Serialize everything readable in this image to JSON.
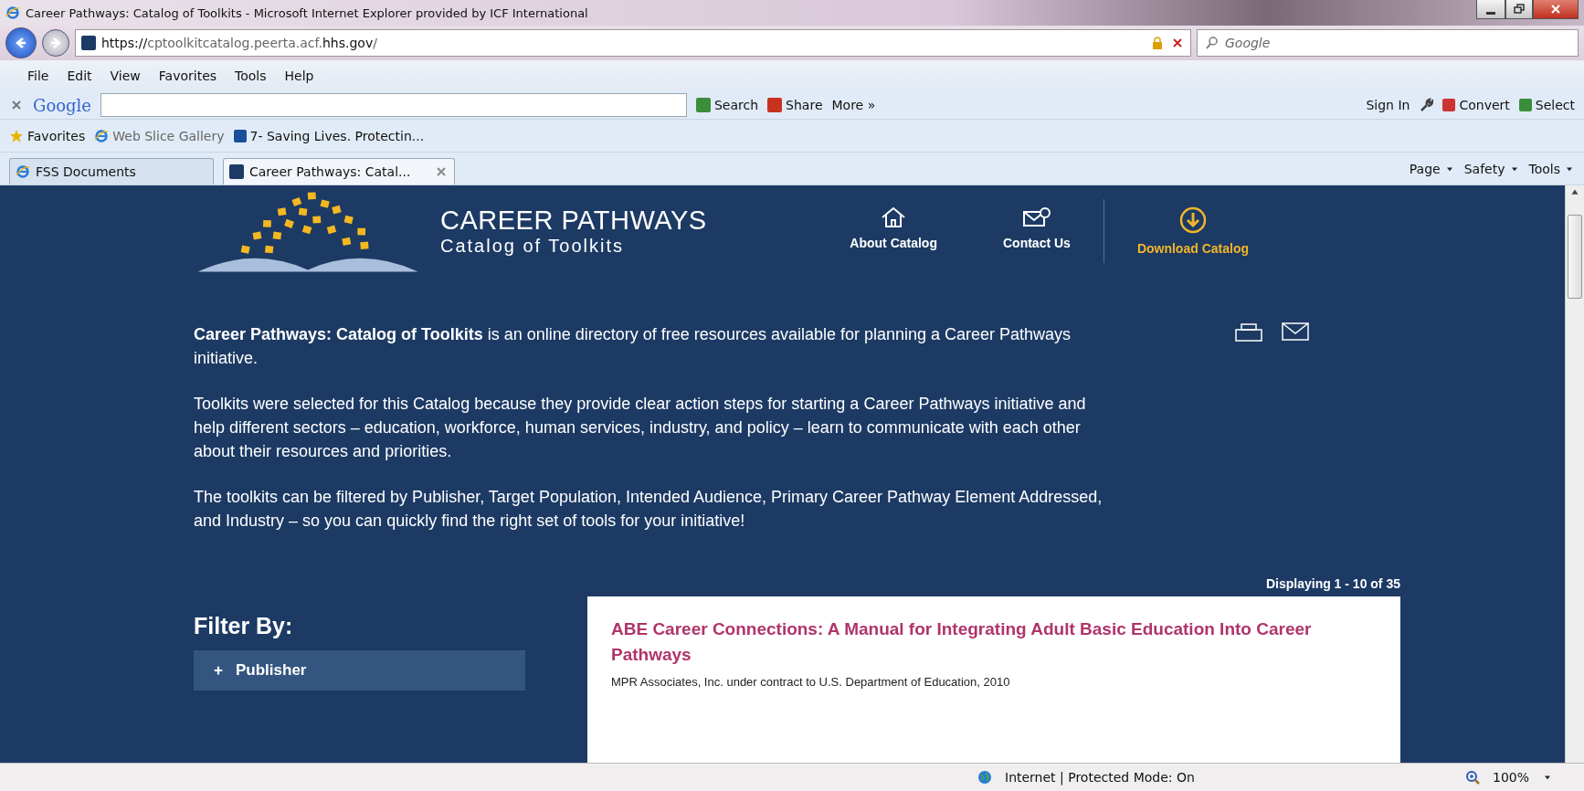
{
  "window": {
    "title": "Career Pathways: Catalog of Toolkits - Microsoft Internet Explorer provided by ICF International"
  },
  "address": {
    "url_prefix": "https://",
    "url_host": "cptoolkitcatalog.peerta.acf.",
    "url_domain": "hhs.gov",
    "url_suffix": "/",
    "search_placeholder": "Google"
  },
  "menu": [
    "File",
    "Edit",
    "View",
    "Favorites",
    "Tools",
    "Help"
  ],
  "google_bar": {
    "logo": "Google",
    "search": "Search",
    "share": "Share",
    "more": "More",
    "more_glyph": "»",
    "sign_in": "Sign In",
    "convert": "Convert",
    "select": "Select"
  },
  "favorites_bar": {
    "favorites": "Favorites",
    "items": [
      {
        "label": "Web Slice Gallery",
        "kind": "ie"
      },
      {
        "label": "7- Saving Lives. Protectin...",
        "kind": "cdc"
      }
    ]
  },
  "tabs": [
    {
      "label": "FSS Documents",
      "selected": false
    },
    {
      "label": "Career Pathways: Catal...",
      "selected": true
    }
  ],
  "command_bar": [
    "Page",
    "Safety",
    "Tools"
  ],
  "page": {
    "logo_title": "CAREER PATHWAYS",
    "logo_subtitle": "Catalog of Toolkits",
    "nav": [
      {
        "label": "About Catalog",
        "kind": "home",
        "selected": false
      },
      {
        "label": "Contact Us",
        "kind": "contact",
        "selected": false
      },
      {
        "label": "Download Catalog",
        "kind": "download",
        "selected": true
      }
    ],
    "paragraphs": [
      "**Career Pathways: Catalog of Toolkits** is an online directory of free resources available for planning a Career Pathways initiative.",
      "Toolkits were selected for this Catalog because they provide clear action steps for starting a Career Pathways initiative and help different sectors – education, workforce, human services, industry, and policy – learn to communicate with each other about their resources and priorities.",
      "The toolkits can be filtered by Publisher, Target Population, Intended Audience, Primary Career Pathway Element Addressed, and Industry – so you can quickly find the right set of tools for your initiative!"
    ],
    "displaying": "Displaying 1 - 10 of 35",
    "filter_title": "Filter By:",
    "filters": [
      {
        "label": "Publisher",
        "expanded": false
      }
    ],
    "results": [
      {
        "title": "ABE Career Connections: A Manual for Integrating Adult Basic Education Into Career Pathways",
        "publisher": "MPR Associates, Inc. under contract to U.S. Department of Education, 2010"
      }
    ]
  },
  "status_bar": {
    "zone": "Internet | Protected Mode: On",
    "zoom": "100%"
  }
}
